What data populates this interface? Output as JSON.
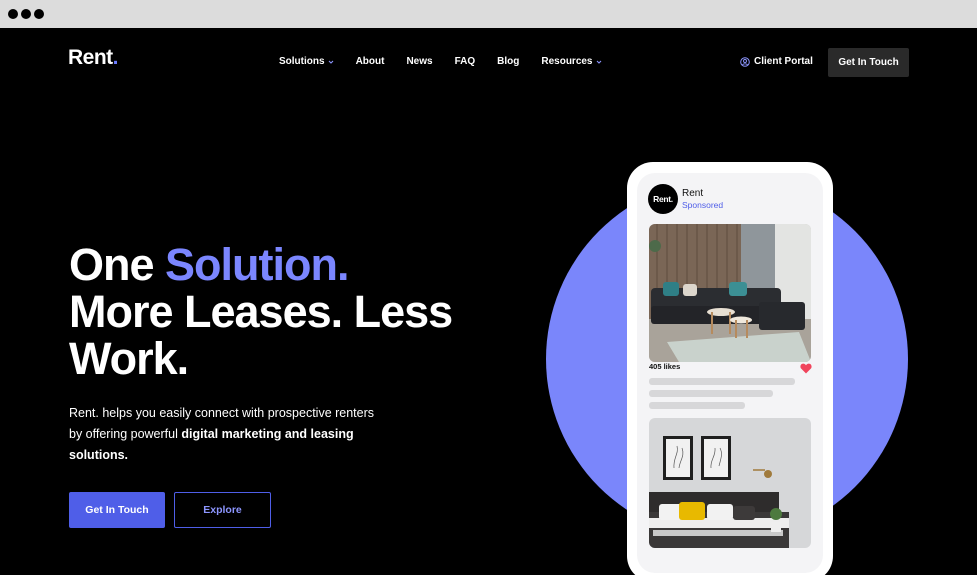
{
  "brand": {
    "name": "Rent",
    "dot": "."
  },
  "nav": {
    "items": [
      {
        "label": "Solutions",
        "dropdown": true
      },
      {
        "label": "About",
        "dropdown": false
      },
      {
        "label": "News",
        "dropdown": false
      },
      {
        "label": "FAQ",
        "dropdown": false
      },
      {
        "label": "Blog",
        "dropdown": false
      },
      {
        "label": "Resources",
        "dropdown": true
      }
    ],
    "portal_label": "Client Portal",
    "cta_label": "Get In Touch"
  },
  "hero": {
    "headline_part1": "One ",
    "headline_accent": "Solution.",
    "headline_part2": "More Leases. Less Work.",
    "sub_text": "Rent. helps you easily connect with prospective renters by offering powerful ",
    "sub_bold": "digital marketing and leasing solutions.",
    "primary_button": "Get In Touch",
    "secondary_button": "Explore"
  },
  "phone_post": {
    "avatar_text": "Rent.",
    "name": "Rent",
    "sponsored": "Sponsored",
    "likes": "405 likes"
  },
  "colors": {
    "accent": "#7b86ff",
    "primary_button": "#4f5ee8",
    "circle": "#7a86fb",
    "background": "#000000",
    "heart": "#f0445c"
  }
}
